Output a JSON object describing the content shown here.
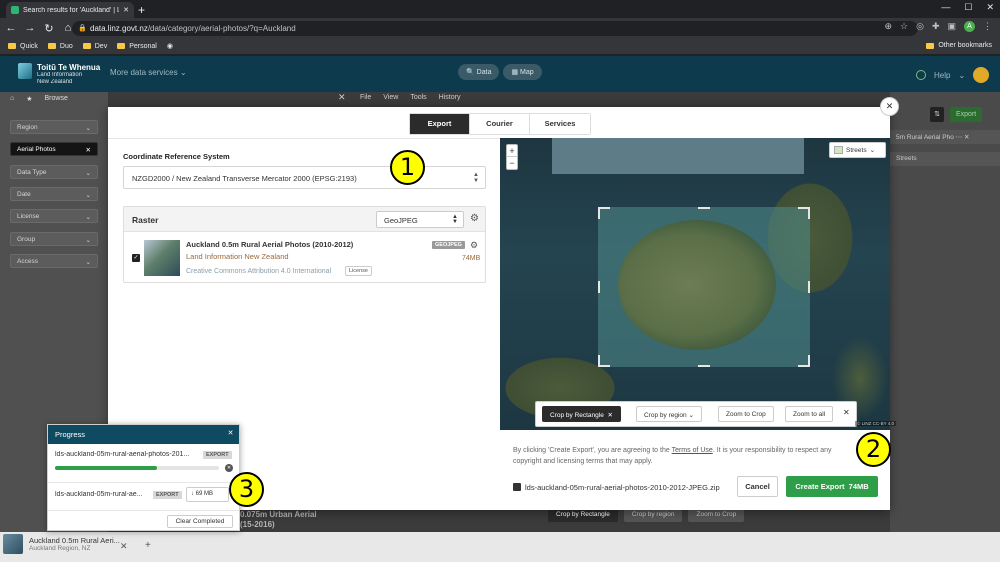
{
  "browser": {
    "tab_title": "Search results for 'Auckland' | LI…",
    "url_host": "data.linz.govt.nz",
    "url_path": "/data/category/aerial-photos/?q=Auckland",
    "bookmarks": [
      "Quick",
      "Duo",
      "Dev",
      "Personal"
    ],
    "other_bookmarks": "Other bookmarks",
    "profile_initial": "A"
  },
  "site": {
    "logo_line1": "Toitū Te Whenua",
    "logo_line2": "Land Information",
    "logo_line3": "New Zealand",
    "more_data_services": "More data services",
    "data_btn": "Data",
    "map_btn": "Map",
    "help": "Help"
  },
  "background": {
    "browse": "Browse",
    "filters": [
      "Region",
      "Aerial Photos",
      "Data Type",
      "Date",
      "License",
      "Group",
      "Access"
    ],
    "toolbar": [
      "File",
      "View",
      "Tools",
      "History"
    ],
    "export_btn": "Export",
    "layer_short": "5m Rural Aerial Pho",
    "streets": "Streets",
    "caption_line1": "0.075m Urban Aerial",
    "caption_line2": "(15-2016)",
    "crop_tools": [
      "Crop by Rectangle",
      "Crop by region",
      "Zoom to Crop"
    ],
    "task_title": "Auckland 0.5m Rural Aeri...",
    "task_sub": "Auckland Region, NZ"
  },
  "modal": {
    "tabs": [
      "Export",
      "Courier",
      "Services"
    ],
    "crs_label": "Coordinate Reference System",
    "crs_value": "NZGD2000 / New Zealand Transverse Mercator 2000 (EPSG:2193)",
    "raster_title": "Raster",
    "format": "GeoJPEG",
    "layer": {
      "name": "Auckland 0.5m Rural Aerial Photos (2010-2012)",
      "org": "Land Information New Zealand",
      "license": "Creative Commons Attribution 4.0 International",
      "license_btn": "License",
      "format_badge": "GEOJPEG",
      "size": "74MB",
      "checked": true
    },
    "map": {
      "basemap": "Streets",
      "zoom_in": "+",
      "zoom_out": "−",
      "crop_tools": [
        "Crop by Rectangle",
        "Crop by region",
        "Zoom to Crop",
        "Zoom to all"
      ],
      "attribution": "© LINZ CC-BY 4.0"
    },
    "terms_pre": "By clicking 'Create Export', you are agreeing to the ",
    "terms_link": "Terms of Use",
    "terms_post": ". It is your responsibility to respect any copyright and licensing terms that may apply.",
    "zip_name": "lds-auckland-05m-rural-aerial-photos-2010-2012-JPEG.zip",
    "cancel": "Cancel",
    "create": "Create Export",
    "create_size": "74MB"
  },
  "progress": {
    "title": "Progress",
    "items": [
      {
        "name": "lds-auckland-05m-rural-aerial-photos-201...",
        "badge": "EXPORT",
        "progress": 0.62
      },
      {
        "name": "lds-auckland-05m-rural-ae...",
        "badge": "EXPORT",
        "size": "69 MB"
      }
    ],
    "clear": "Clear Completed"
  },
  "callouts": [
    "1",
    "2",
    "3"
  ]
}
